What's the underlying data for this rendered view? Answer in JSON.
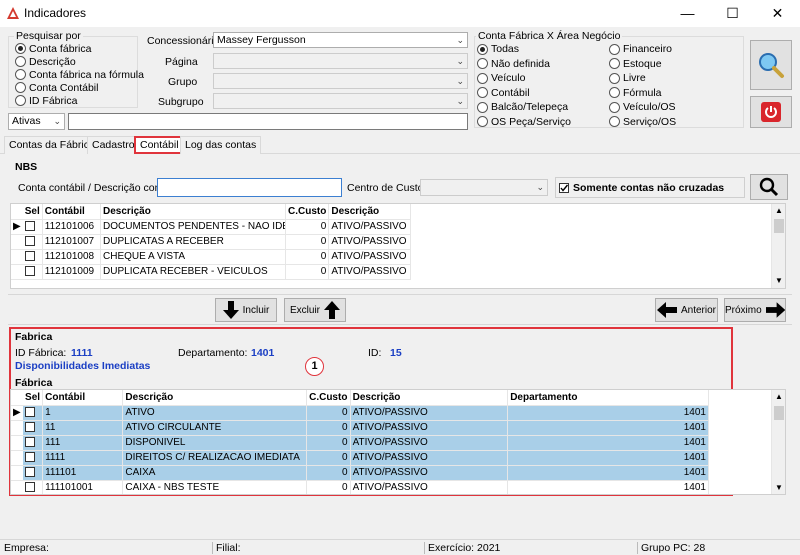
{
  "window": {
    "title": "Indicadores"
  },
  "search": {
    "group_label": "Pesquisar por",
    "options": [
      "Conta fábrica",
      "Descrição",
      "Conta fábrica na fórmula",
      "Conta Contábil",
      "ID Fábrica"
    ],
    "selected": 0,
    "filter_value": "Ativas"
  },
  "filters": {
    "concessionaria_label": "Concessionária",
    "concessionaria_value": "Massey Fergusson",
    "pagina_label": "Página",
    "grupo_label": "Grupo",
    "subgrupo_label": "Subgrupo"
  },
  "area": {
    "label": "Conta Fábrica X Área Negócio",
    "left": [
      "Todas",
      "Não definida",
      "Veículo",
      "Contábil",
      "Balcão/Telepeça",
      "OS Peça/Serviço"
    ],
    "right": [
      "Financeiro",
      "Estoque",
      "Livre",
      "Fórmula",
      "Veículo/OS",
      "Serviço/OS"
    ]
  },
  "tabs": [
    "Contas da Fábrica",
    "Cadastro",
    "Contábil",
    "Log das contas"
  ],
  "nbs": {
    "section_label": "NBS",
    "account_label": "Conta contábil / Descrição conta",
    "center_label": "Centro de Custo",
    "only_uncrossed_label": "Somente contas não cruzadas",
    "columns": [
      "Sel",
      "Contábil",
      "Descrição",
      "C.Custo",
      "Descrição"
    ],
    "rows": [
      [
        "112101006",
        "DOCUMENTOS PENDENTES - NAO IDENTIFIC",
        "0",
        "ATIVO/PASSIVO"
      ],
      [
        "112101007",
        "DUPLICATAS A RECEBER",
        "0",
        "ATIVO/PASSIVO"
      ],
      [
        "112101008",
        "CHEQUE A VISTA",
        "0",
        "ATIVO/PASSIVO"
      ],
      [
        "112101009",
        "DUPLICATA RECEBER - VEICULOS",
        "0",
        "ATIVO/PASSIVO"
      ]
    ]
  },
  "actions": {
    "include": "Incluir",
    "exclude": "Excluir",
    "previous": "Anterior",
    "next": "Próximo"
  },
  "fabrica": {
    "section_label": "Fabrica",
    "id_label": "ID Fábrica:",
    "id_value": "1111",
    "dept_label": "Departamento:",
    "dept_value": "1401",
    "id2_label": "ID:",
    "id2_value": "15",
    "name": "Disponibilidades Imediatas",
    "marker": "1",
    "grid_label": "Fábrica",
    "columns": [
      "Sel",
      "Contábil",
      "Descrição",
      "C.Custo",
      "Descrição",
      "Departamento"
    ],
    "rows": [
      [
        "1",
        "ATIVO",
        "0",
        "ATIVO/PASSIVO",
        "1401"
      ],
      [
        "11",
        "ATIVO CIRCULANTE",
        "0",
        "ATIVO/PASSIVO",
        "1401"
      ],
      [
        "111",
        "DISPONIVEL",
        "0",
        "ATIVO/PASSIVO",
        "1401"
      ],
      [
        "1111",
        "DIREITOS C/ REALIZACAO IMEDIATA",
        "0",
        "ATIVO/PASSIVO",
        "1401"
      ],
      [
        "111101",
        "CAIXA",
        "0",
        "ATIVO/PASSIVO",
        "1401"
      ],
      [
        "111101001",
        "CAIXA - NBS TESTE",
        "0",
        "ATIVO/PASSIVO",
        "1401"
      ]
    ]
  },
  "status": {
    "empresa": "Empresa:",
    "filial": "Filial:",
    "exercicio": "Exercício: 2021",
    "grupo_pc": "Grupo PC: 28"
  },
  "colors": {
    "accent_red": "#e0343c",
    "selection": "#a9cfe8",
    "blue_text": "#1b3fc4"
  }
}
